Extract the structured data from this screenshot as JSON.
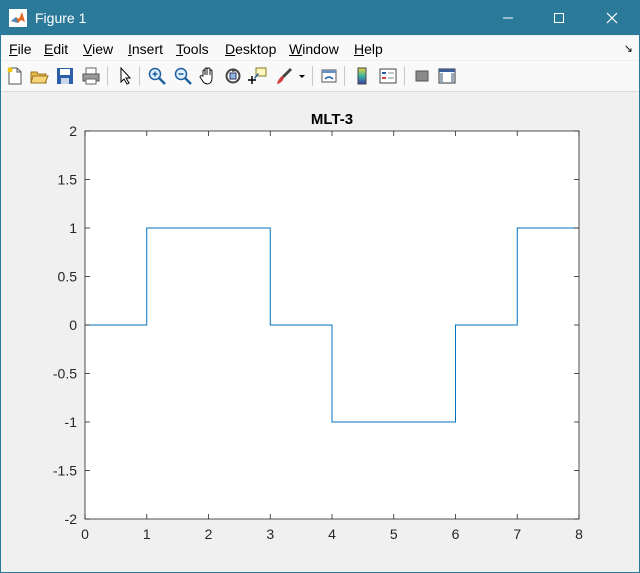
{
  "window": {
    "title": "Figure 1"
  },
  "menu": [
    {
      "label": "File",
      "key": "F",
      "rest": "ile"
    },
    {
      "label": "Edit",
      "key": "E",
      "rest": "dit"
    },
    {
      "label": "View",
      "key": "V",
      "rest": "iew"
    },
    {
      "label": "Insert",
      "key": "I",
      "rest": "nsert"
    },
    {
      "label": "Tools",
      "key": "T",
      "rest": "ools"
    },
    {
      "label": "Desktop",
      "key": "D",
      "rest": "esktop"
    },
    {
      "label": "Window",
      "key": "W",
      "rest": "indow"
    },
    {
      "label": "Help",
      "key": "H",
      "rest": "elp"
    }
  ],
  "toolbar_icons": [
    "new-figure-icon",
    "open-file-icon",
    "save-icon",
    "print-icon",
    "pointer-icon",
    "zoom-in-icon",
    "zoom-out-icon",
    "pan-hand-icon",
    "rotate-3d-icon",
    "data-cursor-icon",
    "brush-icon",
    "link-plot-icon",
    "colorbar-icon",
    "legend-icon",
    "hide-plot-tools-icon",
    "show-plot-tools-icon"
  ],
  "colors": {
    "titlebar": "#2b7a99",
    "line": "#0072bd"
  },
  "chart_data": {
    "type": "line",
    "title": "MLT-3",
    "xlabel": "",
    "ylabel": "",
    "xlim": [
      0,
      8
    ],
    "ylim": [
      -2,
      2
    ],
    "xticks": [
      0,
      1,
      2,
      3,
      4,
      5,
      6,
      7,
      8
    ],
    "yticks": [
      2,
      1.5,
      1,
      0.5,
      0,
      -0.5,
      -1,
      -1.5,
      -2
    ],
    "xtick_labels": [
      "0",
      "1",
      "2",
      "3",
      "4",
      "5",
      "6",
      "7",
      "8"
    ],
    "ytick_labels": [
      "2",
      "1.5",
      "1",
      "0.5",
      "0",
      "-0.5",
      "-1",
      "-1.5",
      "-2"
    ],
    "grid": false,
    "series": [
      {
        "step": "post",
        "x": [
          0,
          1,
          2,
          3,
          4,
          5,
          6,
          7,
          8
        ],
        "y": [
          0,
          1,
          1,
          0,
          -1,
          -1,
          0,
          1,
          1
        ]
      }
    ]
  }
}
